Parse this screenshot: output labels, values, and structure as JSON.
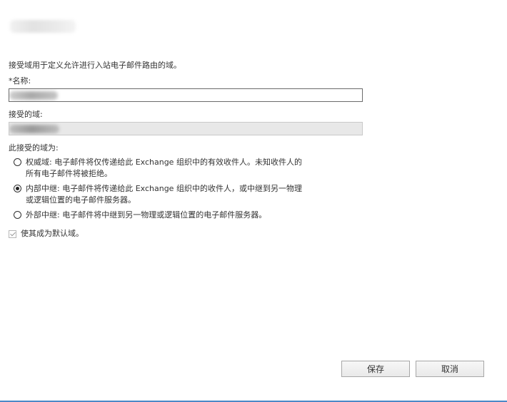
{
  "dialog": {
    "intro_text": "接受域用于定义允许进行入站电子邮件路由的域。",
    "name_label": "*名称:",
    "accepted_domain_label": "接受的域:",
    "domain_type_label": "此接受的域为:",
    "radio_options": [
      {
        "label_line1": "权威域: 电子邮件将仅传递给此 Exchange 组织中的有效收件人。未知收件人的",
        "label_line2": "所有电子邮件将被拒绝。",
        "checked": false
      },
      {
        "label_line1": "内部中继: 电子邮件将传递给此 Exchange 组织中的收件人，或中继到另一物理",
        "label_line2": "或逻辑位置的电子邮件服务器。",
        "checked": true
      },
      {
        "label_line1": "外部中继: 电子邮件将中继到另一物理或逻辑位置的电子邮件服务器。",
        "label_line2": "",
        "checked": false
      }
    ],
    "default_domain_label": "使其成为默认域。",
    "default_domain_checked": true,
    "buttons": {
      "save_label": "保存",
      "cancel_label": "取消"
    }
  },
  "colors": {
    "accent_line": "#4c88c7",
    "text": "#333333",
    "disabled_field": "#e8e8e8"
  }
}
